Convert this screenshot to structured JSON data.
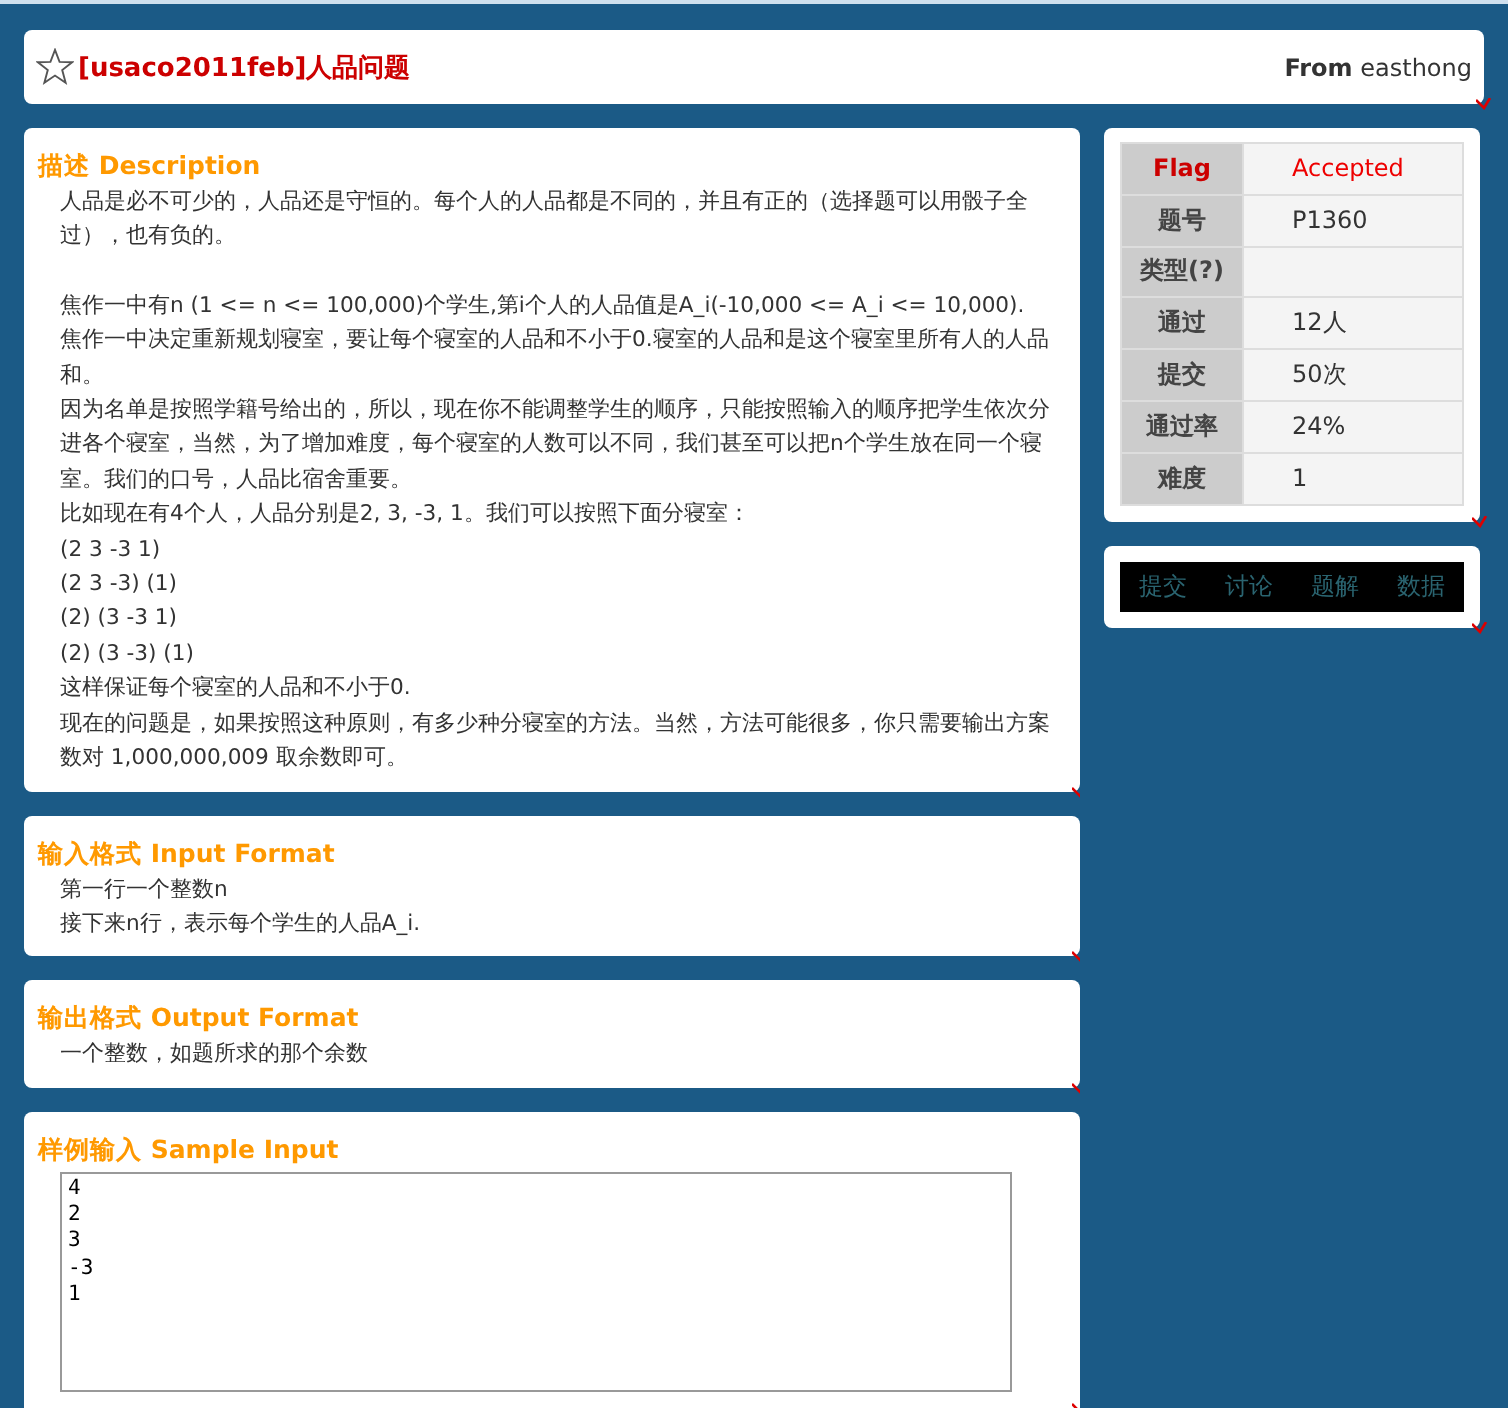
{
  "header": {
    "title": "[usaco2011feb]人品问题",
    "from_label": "From",
    "author": "easthong"
  },
  "sections": [
    {
      "kind": "text",
      "heading": "描述 Description",
      "intro": "人品是必不可少的，人品还是守恒的。每个人的人品都是不同的，并且有正的（选择题可以用骰子全过），也有负的。",
      "paragraphs": [
        "焦作一中有n (1 <= n <= 100,000)个学生,第i个人的人品值是A_i(-10,000 <= A_i <= 10,000).",
        "焦作一中决定重新规划寝室，要让每个寝室的人品和不小于0.寝室的人品和是这个寝室里所有人的人品和。",
        "因为名单是按照学籍号给出的，所以，现在你不能调整学生的顺序，只能按照输入的顺序把学生依次分进各个寝室，当然，为了增加难度，每个寝室的人数可以不同，我们甚至可以把n个学生放在同一个寝室。我们的口号，人品比宿舍重要。",
        "比如现在有4个人，人品分别是2, 3, -3, 1。我们可以按照下面分寝室：",
        "(2 3 -3 1)",
        "(2 3 -3) (1)",
        "(2) (3 -3 1)",
        "(2) (3 -3) (1)",
        "这样保证每个寝室的人品和不小于0.",
        "现在的问题是，如果按照这种原则，有多少种分寝室的方法。当然，方法可能很多，你只需要输出方案数对  1,000,000,009  取余数即可。"
      ]
    },
    {
      "kind": "text",
      "heading": "输入格式 Input Format",
      "paragraphs": [
        "第一行一个整数n",
        "接下来n行，表示每个学生的人品A_i."
      ]
    },
    {
      "kind": "text",
      "heading": "输出格式 Output Format",
      "paragraphs": [
        "一个整数，如题所求的那个余数"
      ]
    },
    {
      "kind": "sample",
      "heading": "样例输入 Sample Input",
      "lines": [
        "4",
        "2",
        "3",
        "-3",
        "1"
      ]
    }
  ],
  "info": [
    {
      "label": "Flag",
      "value": "Accepted",
      "emphasis": true
    },
    {
      "label": "题号",
      "value": "P1360",
      "emphasis": false
    },
    {
      "label": "类型(?)",
      "emphasis": false
    },
    {
      "label": "通过",
      "value": "12人",
      "emphasis": false
    },
    {
      "label": "提交",
      "value": "50次",
      "emphasis": false
    },
    {
      "label": "通过率",
      "value": "24%",
      "emphasis": false
    },
    {
      "label": "难度",
      "value": "1",
      "emphasis": false
    }
  ],
  "nav": [
    "提交",
    "讨论",
    "题解",
    "数据"
  ]
}
